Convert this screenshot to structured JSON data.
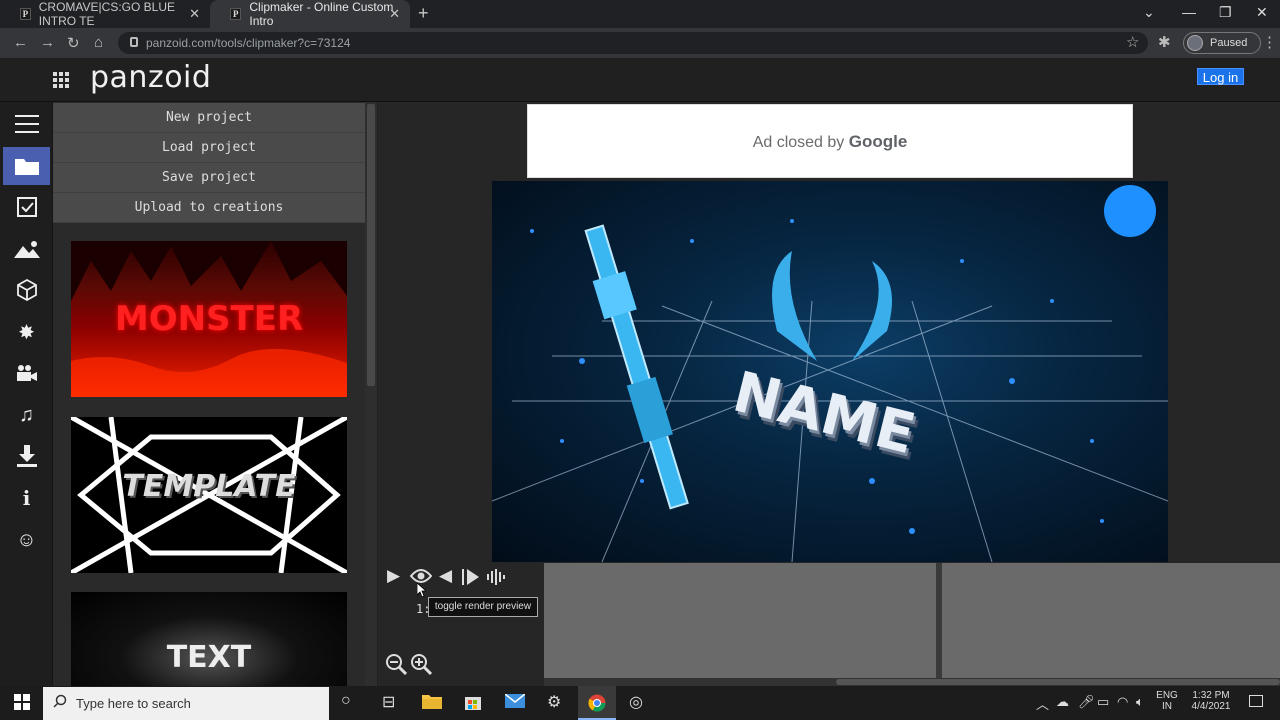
{
  "browser": {
    "tabs": [
      {
        "label": "CROMAVE|CS:GO BLUE INTRO TE",
        "favicon": "P"
      },
      {
        "label": "Clipmaker - Online Custom Intro",
        "favicon": "P"
      }
    ],
    "url": "panzoid.com/tools/clipmaker?c=73124",
    "profile": "Paused"
  },
  "site": {
    "logo": "panzoid",
    "login": "Log in"
  },
  "menu": {
    "items": [
      "New project",
      "Load project",
      "Save project",
      "Upload to creations"
    ]
  },
  "templates": [
    "MONSTER",
    "TEMPLATE",
    "TEXT"
  ],
  "ad": {
    "prefix": "Ad closed by ",
    "brand": "Google"
  },
  "preview": {
    "title_text": "NAME"
  },
  "player": {
    "time": "1:",
    "tooltip": "toggle render preview"
  },
  "taskbar": {
    "search_placeholder": "Type here to search",
    "lang_top": "ENG",
    "lang_bottom": "IN",
    "time": "1:32 PM",
    "date": "4/4/2021"
  },
  "colors": {
    "accent": "#4b5fb0",
    "login": "#1a73e8"
  }
}
